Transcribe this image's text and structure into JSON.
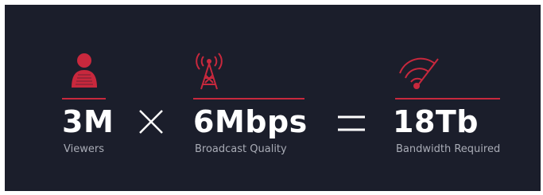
{
  "theme": {
    "background": "#1b1e2b",
    "accent": "#c8283d",
    "text": "#ffffff",
    "caption": "#a9acb6"
  },
  "metrics": [
    {
      "value": "3M",
      "caption": "Viewers",
      "icon": "person-icon"
    },
    {
      "value": "6Mbps",
      "caption": "Broadcast Quality",
      "icon": "broadcast-tower-icon"
    },
    {
      "value": "18Tb",
      "caption": "Bandwidth Required",
      "icon": "speedometer-icon"
    }
  ],
  "operators": {
    "multiply": "×",
    "equals": "="
  }
}
